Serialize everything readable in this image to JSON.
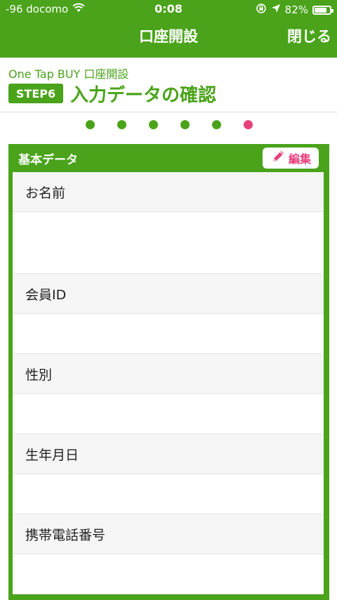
{
  "status_bar": {
    "carrier": "-96 docomo",
    "time": "0:08",
    "battery": "82%",
    "battery_level": 0.82
  },
  "nav": {
    "title": "口座開設",
    "close_label": "閉じる"
  },
  "header": {
    "subtitle": "One Tap BUY 口座開設",
    "step_badge": "STEP6",
    "step_title": "入力データの確認"
  },
  "progress": {
    "steps": 6,
    "current": 6,
    "done_color": "#4aa31a",
    "current_color": "#e8407c"
  },
  "card": {
    "title": "基本データ",
    "edit_label": "編集",
    "rows": [
      {
        "label": "お名前",
        "value": ""
      },
      {
        "label": "会員ID",
        "value": ""
      },
      {
        "label": "性別",
        "value": ""
      },
      {
        "label": "生年月日",
        "value": ""
      },
      {
        "label": "携帯電話番号",
        "value": ""
      }
    ]
  },
  "colors": {
    "accent": "#4aa31a",
    "edit_pink": "#e8407c"
  }
}
